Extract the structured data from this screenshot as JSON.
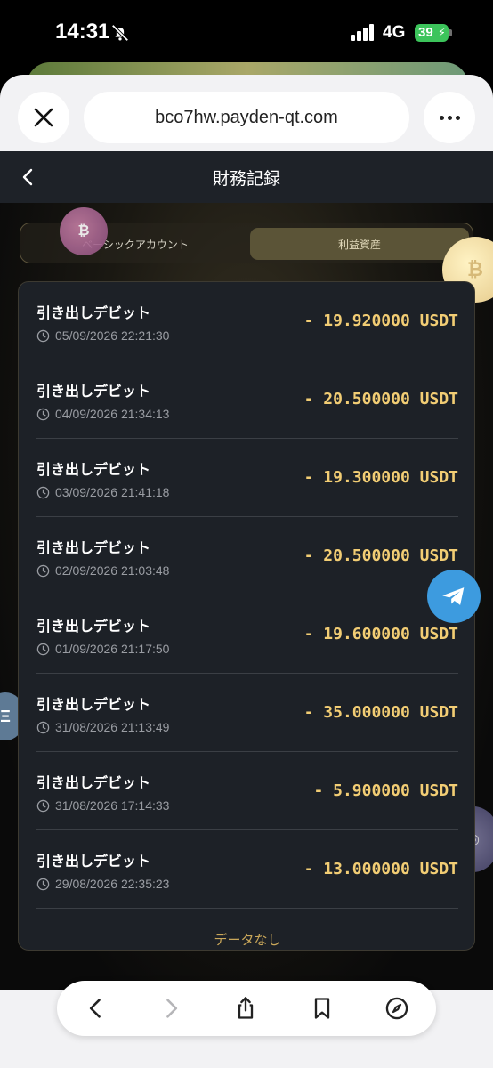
{
  "status_bar": {
    "time": "14:31",
    "network": "4G",
    "battery": "39"
  },
  "browser": {
    "url": "bco7hw.payden-qt.com"
  },
  "header": {
    "title": "財務記録"
  },
  "tabs": [
    {
      "label": "ベーシックアカウント",
      "active": false
    },
    {
      "label": "利益資産",
      "active": true
    }
  ],
  "records": [
    {
      "title": "引き出しデビット",
      "time": "05/09/2026 22:21:30",
      "amount": "- 19.920000 USDT"
    },
    {
      "title": "引き出しデビット",
      "time": "04/09/2026 21:34:13",
      "amount": "- 20.500000 USDT"
    },
    {
      "title": "引き出しデビット",
      "time": "03/09/2026 21:41:18",
      "amount": "- 19.300000 USDT"
    },
    {
      "title": "引き出しデビット",
      "time": "02/09/2026 21:03:48",
      "amount": "- 20.500000 USDT"
    },
    {
      "title": "引き出しデビット",
      "time": "01/09/2026 21:17:50",
      "amount": "- 19.600000 USDT"
    },
    {
      "title": "引き出しデビット",
      "time": "31/08/2026 21:13:49",
      "amount": "- 35.000000 USDT"
    },
    {
      "title": "引き出しデビット",
      "time": "31/08/2026 17:14:33",
      "amount": "- 5.900000 USDT"
    },
    {
      "title": "引き出しデビット",
      "time": "29/08/2026 22:35:23",
      "amount": "- 13.000000 USDT"
    }
  ],
  "no_data_label": "データなし",
  "colors": {
    "amount": "#f2cd74",
    "accent_tab": "#5b5437",
    "telegram": "#3d9bdf"
  },
  "icons": [
    "bell-off-icon",
    "signal-icon",
    "close-icon",
    "more-icon",
    "back-icon",
    "clock-icon",
    "telegram-icon",
    "share-icon",
    "bookmark-icon",
    "compass-icon"
  ]
}
